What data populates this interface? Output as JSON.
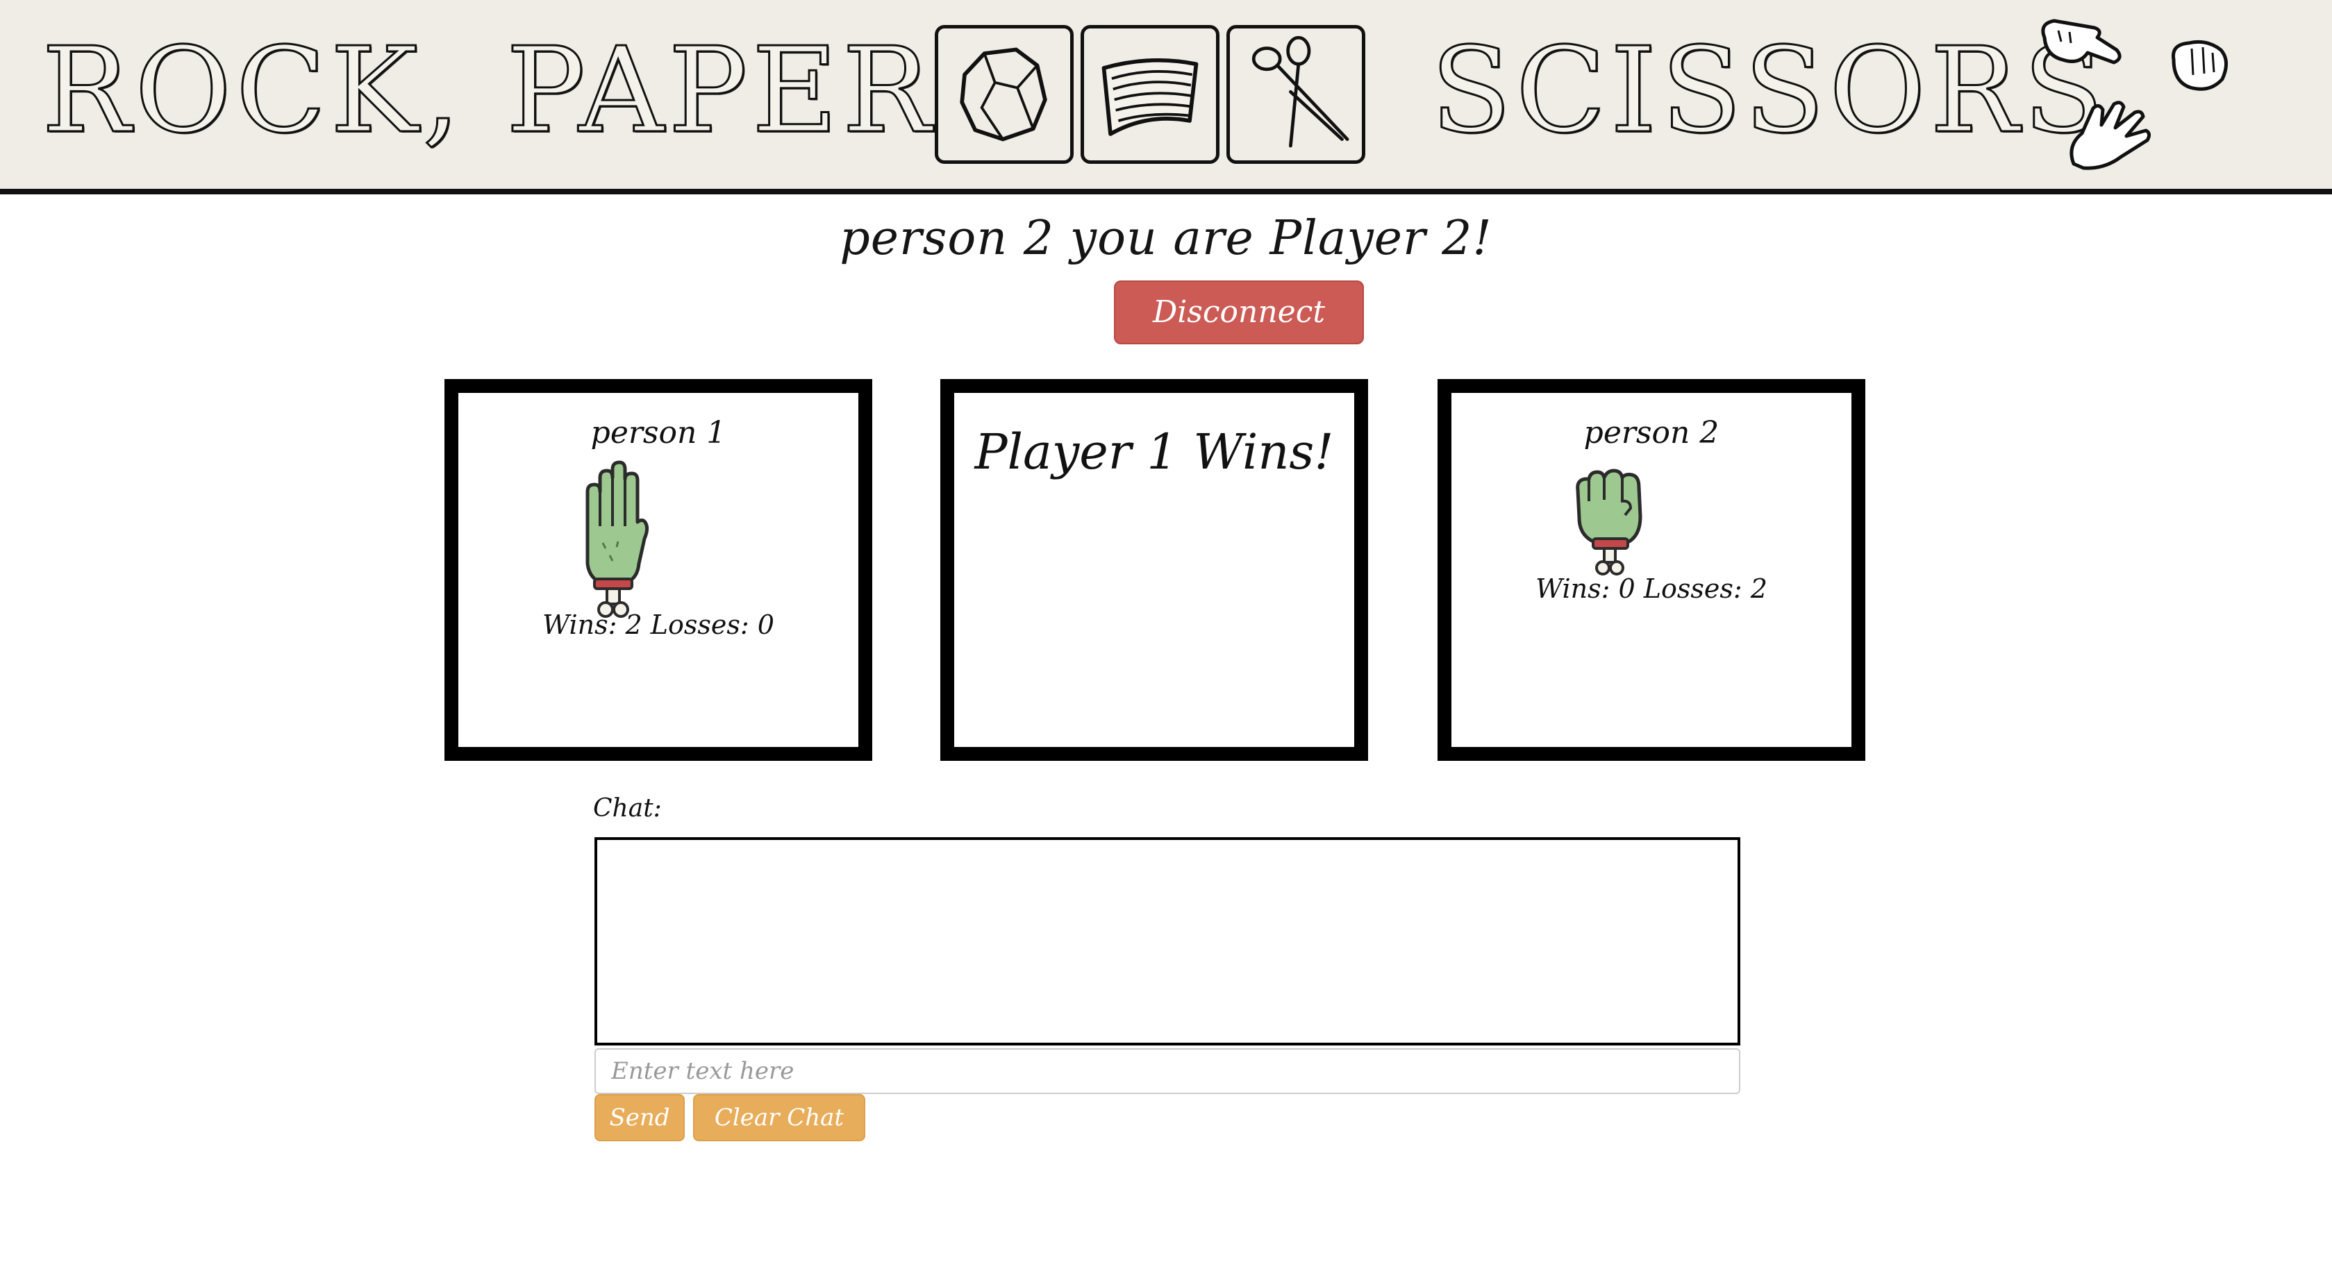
{
  "header": {
    "title_part1": "ROCK, PAPER,",
    "title_part2": "SCISSORS",
    "icons": [
      "rock-icon",
      "paper-icon",
      "scissors-icon"
    ],
    "decorations": [
      "glove-scissors-icon",
      "glove-rock-icon",
      "glove-paper-icon"
    ]
  },
  "status": {
    "heading": "person 2 you are Player 2!",
    "disconnect_label": "Disconnect"
  },
  "players": [
    {
      "name": "person 1",
      "hand_icon": "zombie-hand-paper-icon",
      "score_text": "Wins: 2 Losses: 0"
    },
    {
      "name": "person 2",
      "hand_icon": "zombie-hand-rock-icon",
      "score_text": "Wins: 0 Losses: 2"
    }
  ],
  "result": {
    "text": "Player 1 Wins!"
  },
  "chat": {
    "label": "Chat:",
    "input_value": "",
    "placeholder": "Enter text here",
    "send_label": "Send",
    "clear_label": "Clear Chat"
  },
  "colors": {
    "banner_bg": "#efede5",
    "disconnect": "#cc5a55",
    "chat_buttons": "#e8ad5a",
    "zombie_skin": "#9dc991",
    "zombie_wrist": "#c4474a"
  }
}
